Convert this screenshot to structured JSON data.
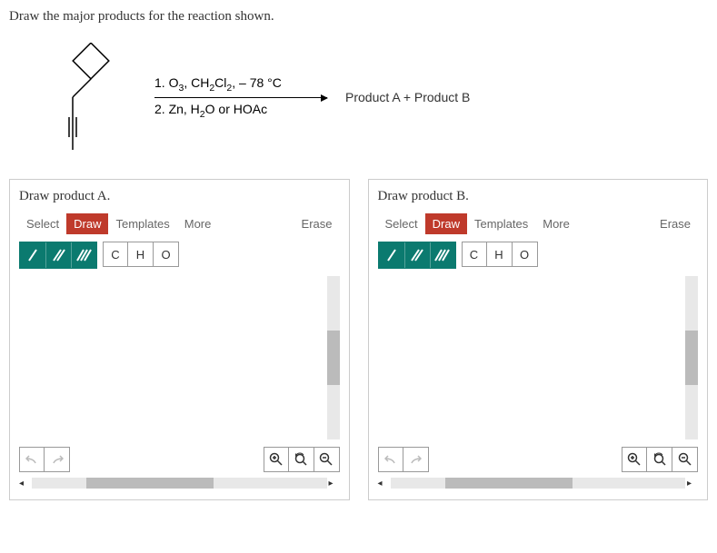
{
  "question": "Draw the major products for the reaction shown.",
  "reaction": {
    "reagent_line1_html": "1. O<sub>3</sub>, CH<sub>2</sub>Cl<sub>2</sub>, – 78 °C",
    "reagent_line2_html": "2. Zn, H<sub>2</sub>O or HOAc",
    "product_label": "Product A + Product B"
  },
  "panelA": {
    "title": "Draw product A.",
    "tabs": {
      "select": "Select",
      "draw": "Draw",
      "templates": "Templates",
      "more": "More"
    },
    "erase": "Erase",
    "bonds": {
      "single": "/",
      "double": "//",
      "triple": "///"
    },
    "elements": {
      "c": "C",
      "h": "H",
      "o": "O"
    },
    "undo": "↺",
    "redo": "↻",
    "zoom": {
      "in": "⊕",
      "reset": "↻⌕",
      "out": "⊖"
    },
    "left_arrow": "◂",
    "right_arrow": "▸"
  },
  "panelB": {
    "title": "Draw product B.",
    "tabs": {
      "select": "Select",
      "draw": "Draw",
      "templates": "Templates",
      "more": "More"
    },
    "erase": "Erase",
    "bonds": {
      "single": "/",
      "double": "//",
      "triple": "///"
    },
    "elements": {
      "c": "C",
      "h": "H",
      "o": "O"
    },
    "undo": "↺",
    "redo": "↻",
    "zoom": {
      "in": "⊕",
      "reset": "↻⌕",
      "out": "⊖"
    },
    "left_arrow": "◂",
    "right_arrow": "▸"
  }
}
